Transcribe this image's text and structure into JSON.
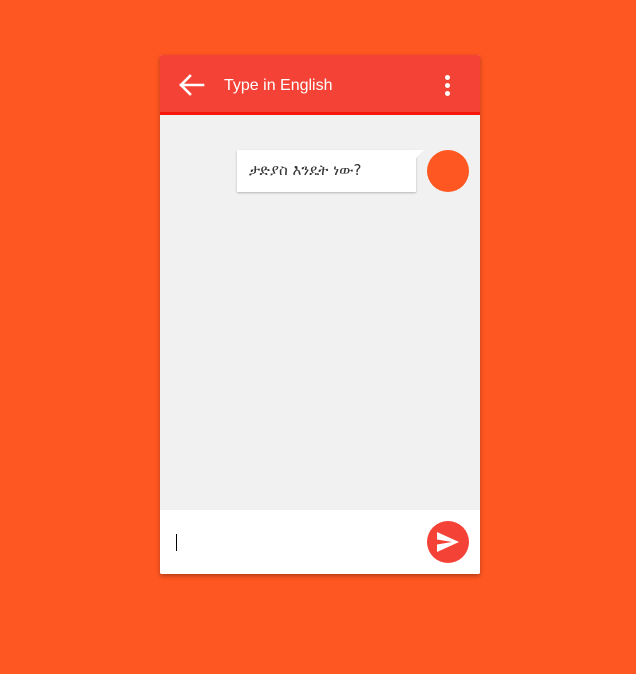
{
  "app": {
    "title": "Type in English"
  },
  "icons": {
    "back": "arrow-left-icon",
    "menu": "more-vertical-icon",
    "send": "send-icon"
  },
  "colors": {
    "background": "#ff5722",
    "appbar": "#f44336",
    "appbar_underline": "#f5180a",
    "chat_area": "#f1f1f1",
    "avatar": "#ff5722",
    "send_button": "#f44336"
  },
  "messages": [
    {
      "text": "ታድያስ እንዴት ነው?",
      "side": "right"
    }
  ],
  "composer": {
    "value": "",
    "placeholder": ""
  }
}
